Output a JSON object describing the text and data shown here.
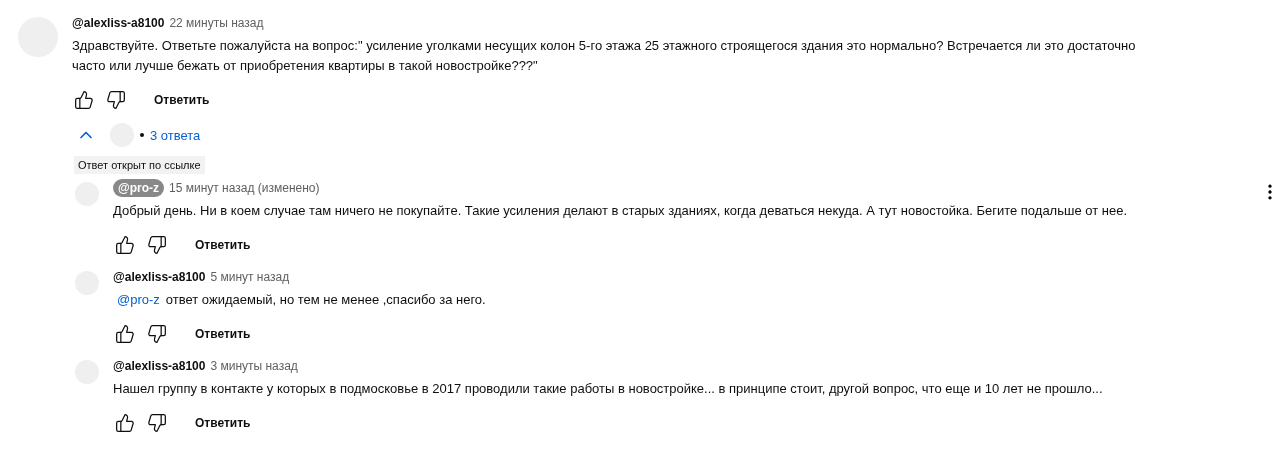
{
  "comment": {
    "author": "@alexliss-a8100",
    "time": "22 минуты назад",
    "text_lines": [
      "Здравствуйте. Ответьте пожалуйста на вопрос:\" усиление уголками несущих колон 5-го этажа 25 этажного строящегося здания это нормально? Встречается ли это достаточно",
      "часто или лучше бежать от приобретения квартиры в такой новостройке???\""
    ],
    "reply_button": "Ответить"
  },
  "replies_toggle": {
    "expanded": true,
    "count": "3 ответа"
  },
  "link_badge": "Ответ открыт по ссылке",
  "replies": [
    {
      "author": "@pro-z",
      "author_highlighted": true,
      "time": "15 минут назад (изменено)",
      "text": "Добрый день. Ни в коем случае там ничего не покупайте. Такие усиления делают в старых зданиях, когда деваться некуда. А тут новостойка. Бегите подальше от нее.",
      "reply_button": "Ответить",
      "menu_visible": true
    },
    {
      "author": "@alexliss-a8100",
      "author_highlighted": false,
      "time": "5 минут назад",
      "mention": "@pro-z",
      "text": "ответ ожидаемый, но тем не менее ,спасибо за него.",
      "reply_button": "Ответить",
      "menu_visible": false
    },
    {
      "author": "@alexliss-a8100",
      "author_highlighted": false,
      "time": "3 минуты назад",
      "text": "Нашел группу в контакте у которых в подмосковье в 2017 проводили такие работы в новостройке... в принципе стоит, другой вопрос, что еще и 10 лет не прошло...",
      "reply_button": "Ответить",
      "menu_visible": false
    }
  ]
}
